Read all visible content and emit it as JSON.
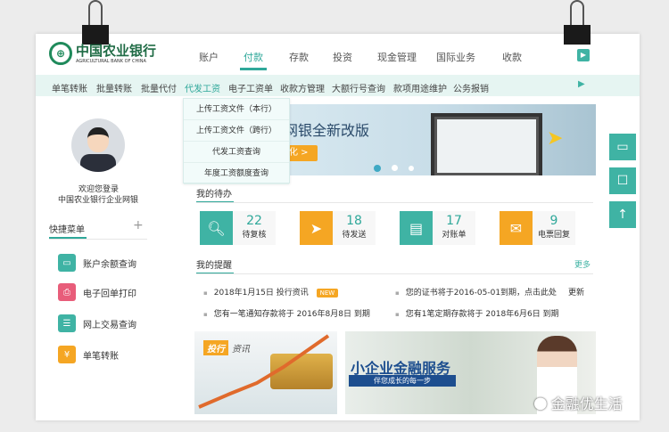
{
  "header": {
    "bank_name": "中国农业银行",
    "bank_name_en": "AGRICULTURAL BANK OF CHINA",
    "nav": [
      "账户",
      "付款",
      "存款",
      "投资",
      "现金管理",
      "国际业务",
      "收款"
    ],
    "active_nav": 1
  },
  "subnav": [
    "单笔转账",
    "批量转账",
    "批量代付",
    "代发工资",
    "电子工资单",
    "收款方管理",
    "大额行号查询",
    "款项用途维护",
    "公务报销"
  ],
  "dropdown": [
    "上传工资文件（本行）",
    "上传工资文件（跨行）",
    "代发工资查询",
    "年度工资额度查询"
  ],
  "user": {
    "welcome": "欢迎您登录",
    "org": "中国农业银行企业网银"
  },
  "quick_menu": {
    "title": "快捷菜单",
    "add": "+",
    "items": [
      "账户余额查询",
      "电子回单打印",
      "网上交易查询",
      "单笔转账"
    ]
  },
  "banner": {
    "headline": "网银全新改版",
    "button": "化 >"
  },
  "todo": {
    "title": "我的待办",
    "items": [
      {
        "count": "22",
        "label": "待复核"
      },
      {
        "count": "18",
        "label": "待发送"
      },
      {
        "count": "17",
        "label": "对账单"
      },
      {
        "count": "9",
        "label": "电票回复"
      }
    ]
  },
  "reminders": {
    "title": "我的提醒",
    "more": "更多",
    "items": [
      "2018年1月15日 投行资讯",
      "您的证书将于2016-05-01到期，点击此处",
      "您有一笔通知存款将于 2016年8月8日 到期",
      "您有1笔定期存款将于 2018年6月6日 到期"
    ],
    "new_badge": "NEW",
    "update_link": "更新"
  },
  "promo": {
    "left_tag": "投行",
    "left_title": "资讯",
    "right_title": "小企业金融服务",
    "right_sub": "伴您成长的每一步"
  },
  "watermark": "金融优生活",
  "colors": {
    "teal": "#3fb3a4",
    "orange": "#f5a623"
  }
}
